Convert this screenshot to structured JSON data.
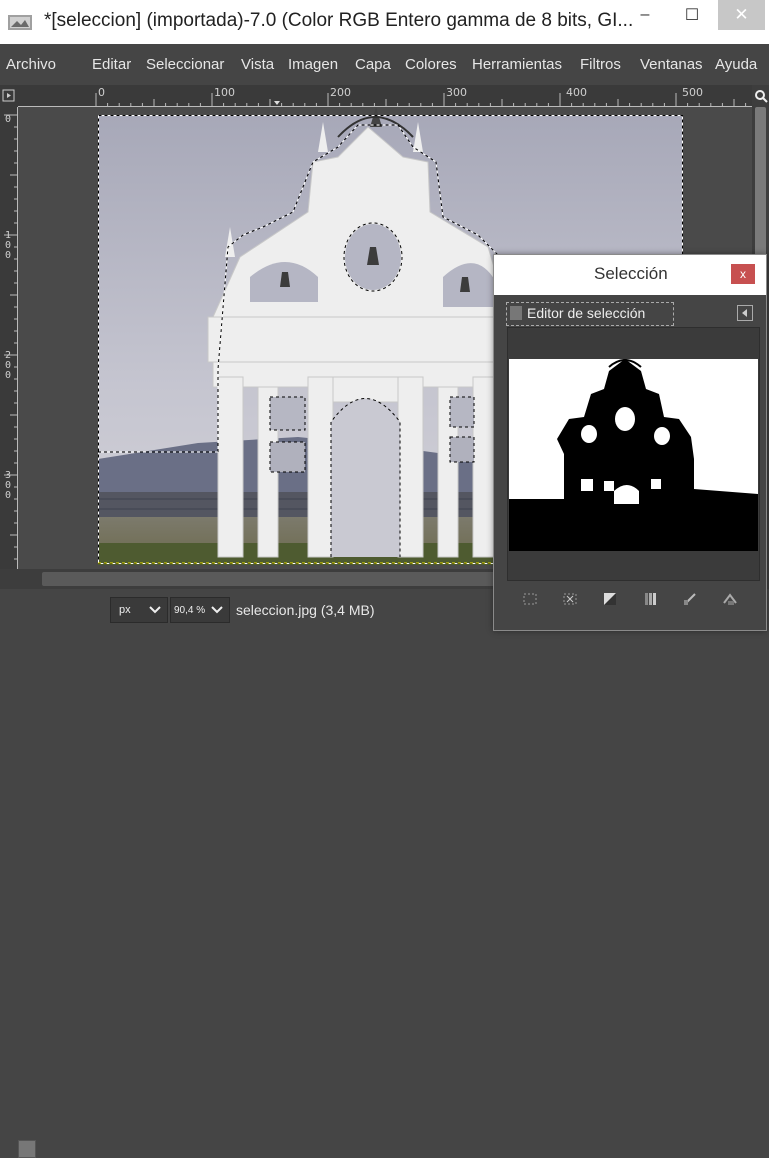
{
  "window": {
    "title": "*[seleccion] (importada)-7.0 (Color RGB Entero gamma de 8 bits, GI...",
    "minimize_glyph": "–",
    "maximize_glyph": "☐",
    "close_glyph": "✕"
  },
  "menu": {
    "items": [
      "Archivo",
      "Editar",
      "Seleccionar",
      "Vista",
      "Imagen",
      "Capa",
      "Colores",
      "Herramientas",
      "Filtros",
      "Ventanas",
      "Ayuda"
    ]
  },
  "ruler": {
    "h_labels": [
      "0",
      "100",
      "200",
      "300",
      "400",
      "500"
    ],
    "v_labels": [
      "0",
      "100",
      "200",
      "300"
    ]
  },
  "status": {
    "unit": "px",
    "zoom": "90,4 %",
    "file_info": "seleccion.jpg (3,4 MB)"
  },
  "dialog": {
    "title": "Selección",
    "close_glyph": "x",
    "tab_label": "Editor de selección",
    "buttons": [
      "select-all-icon",
      "select-none-icon",
      "invert-selection-icon",
      "save-to-channel-icon",
      "stroke-selection-icon",
      "stroke-path-icon"
    ]
  }
}
